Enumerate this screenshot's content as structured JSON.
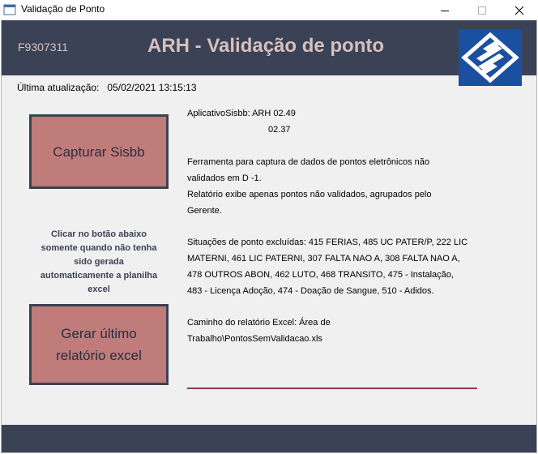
{
  "window": {
    "title": "Validação de Ponto",
    "minimize_glyph": "—",
    "maximize_glyph": "☐",
    "close_glyph": "✕"
  },
  "header": {
    "user_id": "F9307311",
    "title": "ARH - Validação de ponto"
  },
  "last_update": {
    "label": "Última atualização:",
    "value": "05/02/2021 13:15:13"
  },
  "buttons": {
    "capture_label": "Capturar Sisbb",
    "report_line1": "Gerar último",
    "report_line2": "relatório excel"
  },
  "hint": {
    "lines": [
      "Clicar no botão abaixo",
      "somente quando não tenha",
      "sido gerada",
      "automaticamente a planilha",
      "excel"
    ]
  },
  "info": {
    "version_line": "AplicativoSisbb: ARH 02.49",
    "version_sub": "02.37",
    "description_lines": [
      "Ferramenta para captura de dados de pontos eletrônicos não",
      "validados em D -1.",
      "Relatório exibe apenas pontos não validados, agrupados pelo",
      "Gerente."
    ],
    "excluded_lines": [
      "Situações de ponto excluídas: 415 FERIAS, 485 UC PATER/P, 222 LIC",
      "MATERNI, 461 LIC PATERNI, 307 FALTA NAO A, 308 FALTA NAO A,",
      "478 OUTROS ABON, 462 LUTO, 468 TRANSITO,  475 - Instalação,",
      "483 - Licença Adoção, 474 - Doação de Sangue, 510 - Adidos."
    ],
    "path_lines": [
      "Caminho do relatório Excel:  Área de",
      "Trabalho\\PontosSemValidacao.xls"
    ]
  },
  "colors": {
    "header_bg": "#3b4255",
    "button_bg": "#c07b7b",
    "title_text": "#d7bfbf",
    "logo_bg": "#1b4fa0",
    "separator": "#8b3a5a"
  },
  "icons": {
    "app": "app-window-icon",
    "logo": "banco-do-brasil-logo"
  }
}
